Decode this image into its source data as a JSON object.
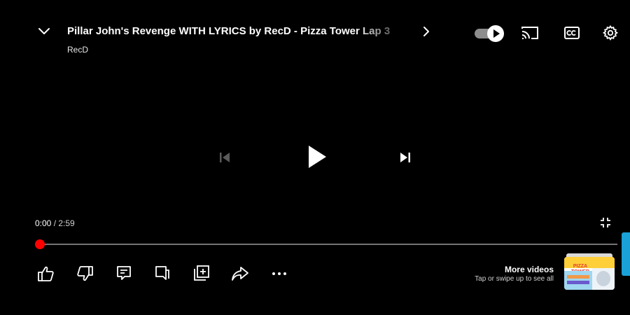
{
  "video": {
    "title": "Pillar John's Revenge WITH LYRICS by RecD - Pizza Tower Lap 3",
    "channel": "RecD"
  },
  "player": {
    "current_time": "0:00",
    "separator": " / ",
    "duration": "2:59",
    "progress_fraction": 0.0,
    "autoplay_on": true,
    "state": "paused"
  },
  "icons": {
    "collapse": "chevron-down-icon",
    "next_title": "chevron-right-icon",
    "autoplay": "autoplay-toggle",
    "cast": "cast-icon",
    "captions": "cc-icon",
    "settings": "gear-icon",
    "previous": "previous-icon",
    "play": "play-icon",
    "next": "next-icon",
    "exit_fullscreen": "exit-fullscreen-icon",
    "like": "thumbs-up-icon",
    "dislike": "thumbs-down-icon",
    "comments": "comment-icon",
    "live_chat": "chat-icon",
    "save": "add-to-playlist-icon",
    "share": "share-icon",
    "more": "more-horizontal-icon"
  },
  "more_videos": {
    "title": "More videos",
    "subtitle": "Tap or swipe up to see all",
    "thumbnail_text_line1": "PIZZA TOWER"
  },
  "colors": {
    "progress_thumb": "#ff0000",
    "edge_tab": "#1aa1d8",
    "background": "#000000"
  }
}
